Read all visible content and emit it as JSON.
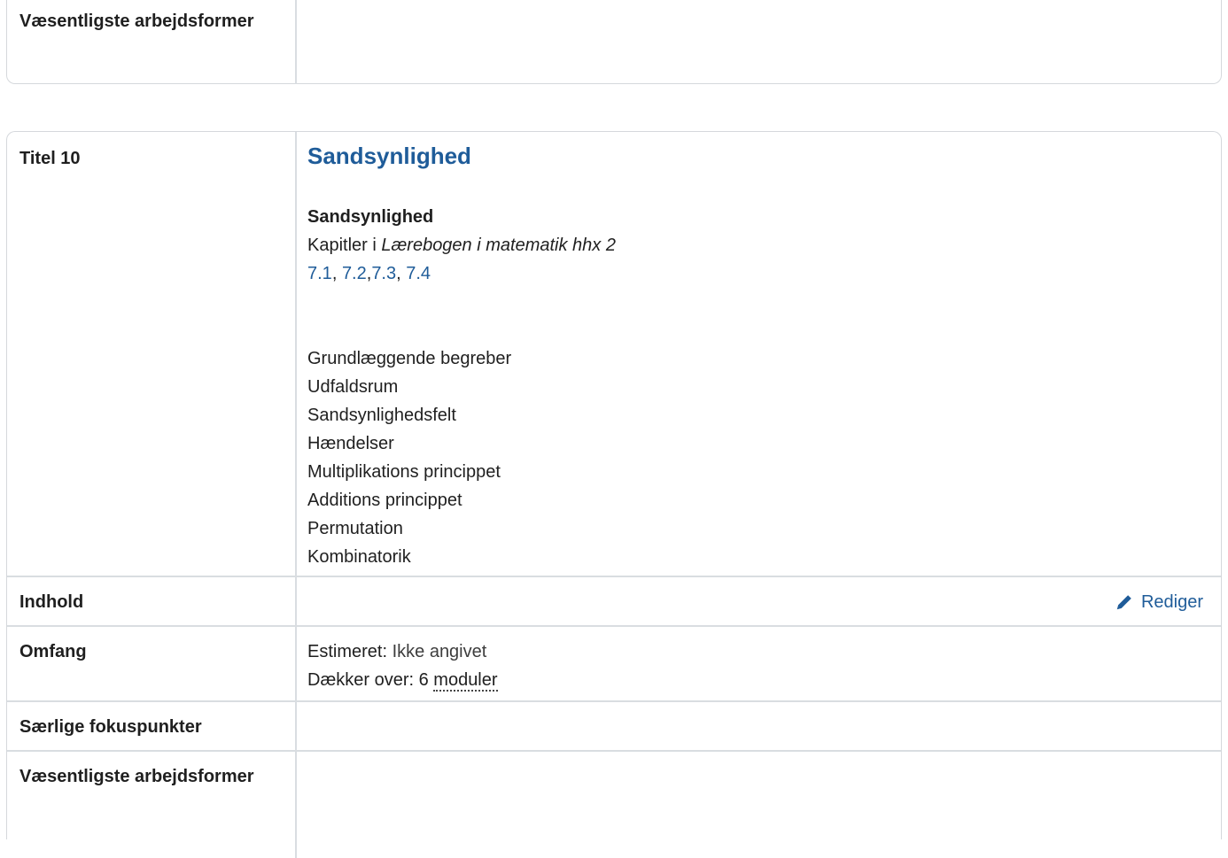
{
  "top_section": {
    "label": "Væsentligste arbejdsformer",
    "value": ""
  },
  "main_section": {
    "title_label": "Titel 10",
    "title": "Sandsynlighed",
    "subheading": "Sandsynlighed",
    "chapters_prefix": "Kapitler i ",
    "chapters_book": "Lærebogen i matematik hhx 2",
    "chapter_links": [
      "7.1",
      "7.2",
      "7.3",
      "7.4"
    ],
    "topics": [
      "Grundlæggende begreber",
      "Udfaldsrum",
      "Sandsynlighedsfelt",
      "Hændelser",
      "Multiplikations princippet",
      "Additions princippet",
      "Permutation",
      "Kombinatorik"
    ],
    "indhold_label": "Indhold",
    "edit_label": "Rediger",
    "edit_icon": "pencil-icon",
    "omfang_label": "Omfang",
    "estimated_label": "Estimeret: ",
    "estimated_value": "Ikke angivet",
    "covers_label": "Dækker over: ",
    "covers_count": "6",
    "covers_unit": "moduler",
    "focus_label": "Særlige fokuspunkter",
    "workforms_label": "Væsentligste arbejdsformer"
  },
  "colors": {
    "accent": "#1f5c99",
    "border": "#d9dde1"
  }
}
